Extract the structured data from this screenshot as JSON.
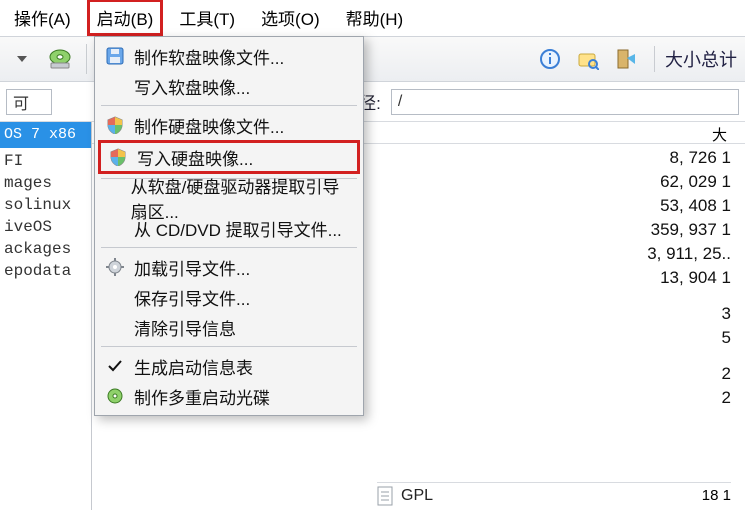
{
  "menubar": {
    "operate": "操作(A)",
    "boot": "启动(B)",
    "tools": "工具(T)",
    "options": "选项(O)",
    "help": "帮助(H)"
  },
  "toolbar": {
    "total_label": "大小总计"
  },
  "addressbar": {
    "label": "路径:",
    "path": "/",
    "field_placeholder_left": "可"
  },
  "leftpane": {
    "header": "OS 7 x86",
    "items": [
      "FI",
      "mages",
      "solinux",
      "iveOS",
      "ackages",
      "epodata"
    ]
  },
  "rightpane": {
    "size_header": "大",
    "sizes": [
      "8, 726 1",
      "62, 029 1",
      "53, 408 1",
      "359, 937 1",
      "3, 911, 25..",
      "13, 904 1",
      "3",
      "5",
      "2",
      "2"
    ],
    "gpl_label": "GPL",
    "gpl_size": "18 1"
  },
  "dropdown": {
    "make_floppy": "制作软盘映像文件...",
    "write_floppy": "写入软盘映像...",
    "make_hdd": "制作硬盘映像文件...",
    "write_hdd": "写入硬盘映像...",
    "extract_boot_fd": "从软盘/硬盘驱动器提取引导扇区...",
    "extract_boot_cd": "从 CD/DVD 提取引导文件...",
    "load_boot": "加载引导文件...",
    "save_boot": "保存引导文件...",
    "clear_boot": "清除引导信息",
    "gen_boot_table": "生成启动信息表",
    "make_multiboot": "制作多重启动光碟"
  }
}
